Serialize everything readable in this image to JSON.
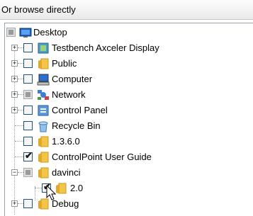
{
  "header": {
    "title": "Or browse directly"
  },
  "tree": {
    "items": [
      {
        "label": "Desktop",
        "icon": "desktop-icon",
        "checked": "partial"
      },
      {
        "label": "Testbench Axceler Display",
        "icon": "application-icon",
        "checked": "none"
      },
      {
        "label": "Public",
        "icon": "folder-icon",
        "checked": "none"
      },
      {
        "label": "Computer",
        "icon": "computer-icon",
        "checked": "none"
      },
      {
        "label": "Network",
        "icon": "network-icon",
        "checked": "partial"
      },
      {
        "label": "Control Panel",
        "icon": "control-panel-icon",
        "checked": "none"
      },
      {
        "label": "Recycle Bin",
        "icon": "recycle-bin-icon",
        "checked": "none"
      },
      {
        "label": "1.3.6.0",
        "icon": "folder-icon",
        "checked": "none"
      },
      {
        "label": "ControlPoint User Guide",
        "icon": "folder-icon",
        "checked": "checked"
      },
      {
        "label": "davinci",
        "icon": "folder-icon",
        "checked": "partial"
      },
      {
        "label": "2.0",
        "icon": "folder-icon",
        "checked": "checked"
      },
      {
        "label": "Debug",
        "icon": "folder-icon",
        "checked": "none"
      }
    ]
  },
  "colors": {
    "folder": "#f2c54a",
    "check_border": "#1c5180",
    "tree_line": "#9a9a9a"
  }
}
